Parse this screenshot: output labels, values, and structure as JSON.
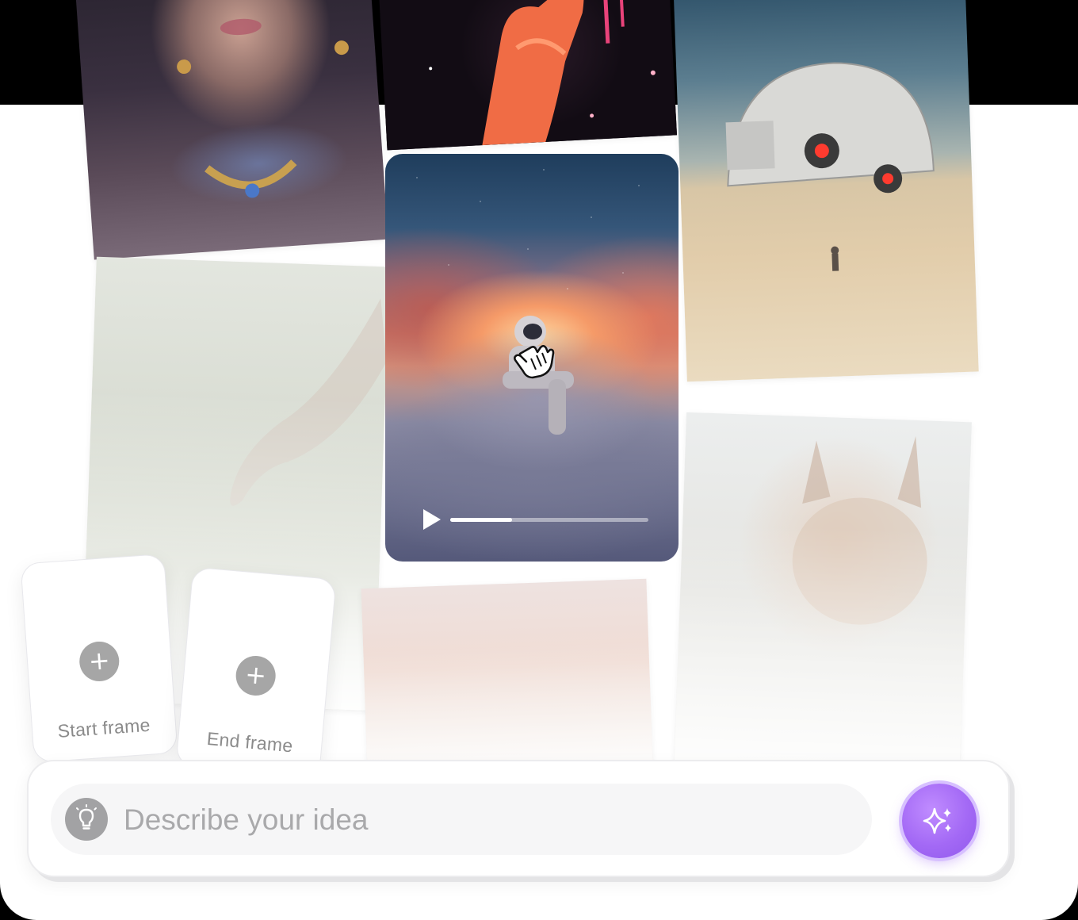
{
  "video": {
    "progress": 0.31
  },
  "frames": {
    "start_label": "Start frame",
    "end_label": "End frame"
  },
  "prompt": {
    "placeholder": "Describe your idea"
  },
  "icons": {
    "idea": "lightbulb-icon",
    "generate": "sparkles-icon",
    "add": "plus-icon",
    "play": "play-icon",
    "cursor": "hand-cursor-icon"
  },
  "colors": {
    "accent": "#a369f5",
    "icon_gray": "#a6a6a6",
    "placeholder": "#a9a9ab"
  }
}
